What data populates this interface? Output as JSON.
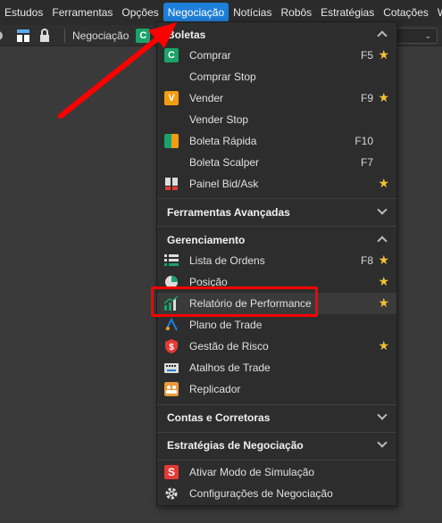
{
  "menubar": {
    "items": [
      "Estudos",
      "Ferramentas",
      "Opções",
      "Negociação",
      "Notícias",
      "Robôs",
      "Estratégias",
      "Cotações",
      "Workspace"
    ]
  },
  "toolbar": {
    "label": "Negociação",
    "badge": "C"
  },
  "dropdown": {
    "boletas": {
      "title": "Boletas",
      "items": [
        {
          "label": "Comprar",
          "shortcut": "F5",
          "star": "★",
          "icon": "C"
        },
        {
          "label": "Comprar Stop",
          "shortcut": "",
          "star": ""
        },
        {
          "label": "Vender",
          "shortcut": "F9",
          "star": "★",
          "icon": "V"
        },
        {
          "label": "Vender Stop",
          "shortcut": "",
          "star": ""
        },
        {
          "label": "Boleta Rápida",
          "shortcut": "F10",
          "star": ""
        },
        {
          "label": "Boleta Scalper",
          "shortcut": "F7",
          "star": ""
        },
        {
          "label": "Painel Bid/Ask",
          "shortcut": "",
          "star": "★"
        }
      ]
    },
    "ferramentas": {
      "title": "Ferramentas Avançadas"
    },
    "gerenciamento": {
      "title": "Gerenciamento",
      "items": [
        {
          "label": "Lista de Ordens",
          "shortcut": "F8",
          "star": "★"
        },
        {
          "label": "Posição",
          "shortcut": "",
          "star": "★"
        },
        {
          "label": "Relatório de Performance",
          "shortcut": "",
          "star": "★"
        },
        {
          "label": "Plano de Trade",
          "shortcut": "",
          "star": ""
        },
        {
          "label": "Gestão de Risco",
          "shortcut": "",
          "star": "★"
        },
        {
          "label": "Atalhos de Trade",
          "shortcut": "",
          "star": ""
        },
        {
          "label": "Replicador",
          "shortcut": "",
          "star": ""
        }
      ]
    },
    "contas": {
      "title": "Contas e Corretoras"
    },
    "estrategias": {
      "title": "Estratégias de Negociação"
    },
    "bottom": {
      "items": [
        {
          "label": "Ativar Modo de Simulação",
          "icon": "S"
        },
        {
          "label": "Configurações de Negociação"
        }
      ]
    }
  },
  "colors": {
    "accent": "#1e7fd8",
    "annotation": "#ff0000",
    "star": "#f2c230"
  }
}
